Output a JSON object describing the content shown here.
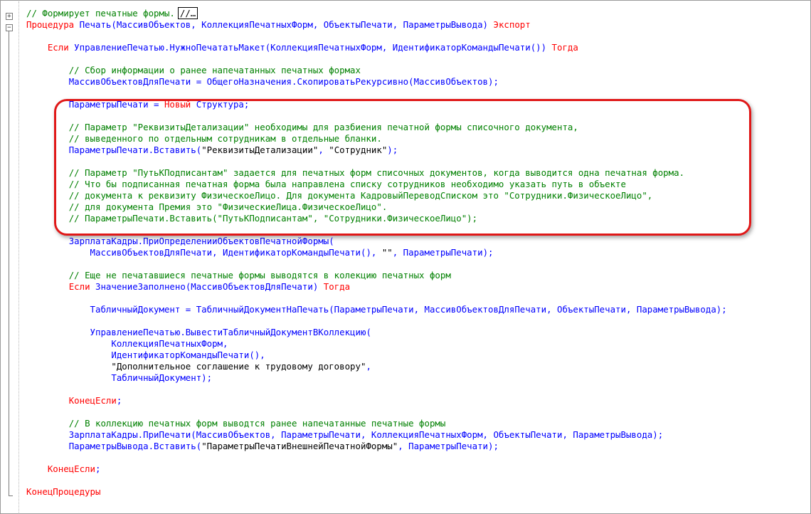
{
  "editor": {
    "collapsed_marker": "//…",
    "lines": [
      [
        {
          "t": "cm",
          "v": "// Формирует печатные формы."
        },
        {
          "t": "box",
          "v": "//…"
        }
      ],
      [
        {
          "t": "kw",
          "v": "Процедура "
        },
        {
          "t": "id",
          "v": "Печать(МассивОбъектов, КоллекцияПечатныхФорм, ОбъектыПечати, ПараметрыВывода) "
        },
        {
          "t": "kw",
          "v": "Экспорт"
        }
      ],
      [],
      [
        {
          "t": "sp",
          "v": "    "
        },
        {
          "t": "kw",
          "v": "Если "
        },
        {
          "t": "id",
          "v": "УправлениеПечатью.НужноПечататьМакет(КоллекцияПечатныхФорм, ИдентификаторКомандыПечати()) "
        },
        {
          "t": "kw",
          "v": "Тогда"
        }
      ],
      [],
      [
        {
          "t": "sp",
          "v": "        "
        },
        {
          "t": "cm",
          "v": "// Сбор информации о ранее напечатанных печатных формах"
        }
      ],
      [
        {
          "t": "sp",
          "v": "        "
        },
        {
          "t": "id",
          "v": "МассивОбъектовДляПечати = ОбщегоНазначения.СкопироватьРекурсивно(МассивОбъектов);"
        }
      ],
      [],
      [
        {
          "t": "sp",
          "v": "        "
        },
        {
          "t": "id",
          "v": "ПараметрыПечати = "
        },
        {
          "t": "kw",
          "v": "Новый "
        },
        {
          "t": "id",
          "v": "Структура;"
        }
      ],
      [],
      [
        {
          "t": "sp",
          "v": "        "
        },
        {
          "t": "cm",
          "v": "// Параметр \"РеквизитыДетализации\" необходимы для разбиения печатной формы списочного документа,"
        }
      ],
      [
        {
          "t": "sp",
          "v": "        "
        },
        {
          "t": "cm",
          "v": "// выведенного по отдельным сотрудникам в отдельные бланки."
        }
      ],
      [
        {
          "t": "sp",
          "v": "        "
        },
        {
          "t": "id",
          "v": "ПараметрыПечати.Вставить("
        },
        {
          "t": "st",
          "v": "\"РеквизитыДетализации\""
        },
        {
          "t": "id",
          "v": ", "
        },
        {
          "t": "st",
          "v": "\"Сотрудник\""
        },
        {
          "t": "id",
          "v": ");"
        }
      ],
      [],
      [
        {
          "t": "sp",
          "v": "        "
        },
        {
          "t": "cm",
          "v": "// Параметр \"ПутьКПодписантам\" задается для печатных форм списочных документов, когда выводится одна печатная форма."
        }
      ],
      [
        {
          "t": "sp",
          "v": "        "
        },
        {
          "t": "cm",
          "v": "// Что бы подписанная печатная форма была направлена списку сотрудников необходимо указать путь в объекте"
        }
      ],
      [
        {
          "t": "sp",
          "v": "        "
        },
        {
          "t": "cm",
          "v": "// документа к реквизиту ФизическоеЛицо. Для документа КадровыйПереводСписком это \"Сотрудники.ФизическоеЛицо\","
        }
      ],
      [
        {
          "t": "sp",
          "v": "        "
        },
        {
          "t": "cm",
          "v": "// для документа Премия это \"ФизическиеЛица.ФизическоеЛицо\"."
        }
      ],
      [
        {
          "t": "sp",
          "v": "        "
        },
        {
          "t": "cm",
          "v": "// ПараметрыПечати.Вставить(\"ПутьКПодписантам\", \"Сотрудники.ФизическоеЛицо\");"
        }
      ],
      [],
      [
        {
          "t": "sp",
          "v": "        "
        },
        {
          "t": "id",
          "v": "ЗарплатаКадры.ПриОпределенииОбъектовПечатнойФормы("
        }
      ],
      [
        {
          "t": "sp",
          "v": "            "
        },
        {
          "t": "id",
          "v": "МассивОбъектовДляПечати, ИдентификаторКомандыПечати(), "
        },
        {
          "t": "st",
          "v": "\"\""
        },
        {
          "t": "id",
          "v": ", ПараметрыПечати);"
        }
      ],
      [],
      [
        {
          "t": "sp",
          "v": "        "
        },
        {
          "t": "cm",
          "v": "// Еще не печатавшиеся печатные формы выводятся в колекцию печатных форм"
        }
      ],
      [
        {
          "t": "sp",
          "v": "        "
        },
        {
          "t": "kw",
          "v": "Если "
        },
        {
          "t": "id",
          "v": "ЗначениеЗаполнено(МассивОбъектовДляПечати) "
        },
        {
          "t": "kw",
          "v": "Тогда"
        }
      ],
      [],
      [
        {
          "t": "sp",
          "v": "            "
        },
        {
          "t": "id",
          "v": "ТабличныйДокумент = ТабличныйДокументНаПечать(ПараметрыПечати, МассивОбъектовДляПечати, ОбъектыПечати, ПараметрыВывода);"
        }
      ],
      [],
      [
        {
          "t": "sp",
          "v": "            "
        },
        {
          "t": "id",
          "v": "УправлениеПечатью.ВывестиТабличныйДокументВКоллекцию("
        }
      ],
      [
        {
          "t": "sp",
          "v": "                "
        },
        {
          "t": "id",
          "v": "КоллекцияПечатныхФорм,"
        }
      ],
      [
        {
          "t": "sp",
          "v": "                "
        },
        {
          "t": "id",
          "v": "ИдентификаторКомандыПечати(),"
        }
      ],
      [
        {
          "t": "sp",
          "v": "                "
        },
        {
          "t": "st",
          "v": "\"Дополнительное соглашение к трудовому договору\""
        },
        {
          "t": "id",
          "v": ","
        }
      ],
      [
        {
          "t": "sp",
          "v": "                "
        },
        {
          "t": "id",
          "v": "ТабличныйДокумент);"
        }
      ],
      [],
      [
        {
          "t": "sp",
          "v": "        "
        },
        {
          "t": "kw",
          "v": "КонецЕсли"
        },
        {
          "t": "id",
          "v": ";"
        }
      ],
      [],
      [
        {
          "t": "sp",
          "v": "        "
        },
        {
          "t": "cm",
          "v": "// В коллекцию печатных форм выводтся ранее напечатанные печатные формы"
        }
      ],
      [
        {
          "t": "sp",
          "v": "        "
        },
        {
          "t": "id",
          "v": "ЗарплатаКадры.ПриПечати(МассивОбъектов, ПараметрыПечати, КоллекцияПечатныхФорм, ОбъектыПечати, ПараметрыВывода);"
        }
      ],
      [
        {
          "t": "sp",
          "v": "        "
        },
        {
          "t": "id",
          "v": "ПараметрыВывода.Вставить("
        },
        {
          "t": "st",
          "v": "\"ПараметрыПечатиВнешнейПечатнойФормы\""
        },
        {
          "t": "id",
          "v": ", ПараметрыПечати);"
        }
      ],
      [],
      [
        {
          "t": "sp",
          "v": "    "
        },
        {
          "t": "kw",
          "v": "КонецЕсли"
        },
        {
          "t": "id",
          "v": ";"
        }
      ],
      [],
      [
        {
          "t": "kw",
          "v": "КонецПроцедуры"
        }
      ]
    ]
  },
  "colors": {
    "keyword": "#ff0000",
    "comment": "#008000",
    "identifier": "#0000ff",
    "string": "#000000",
    "highlight": "#e01818"
  }
}
